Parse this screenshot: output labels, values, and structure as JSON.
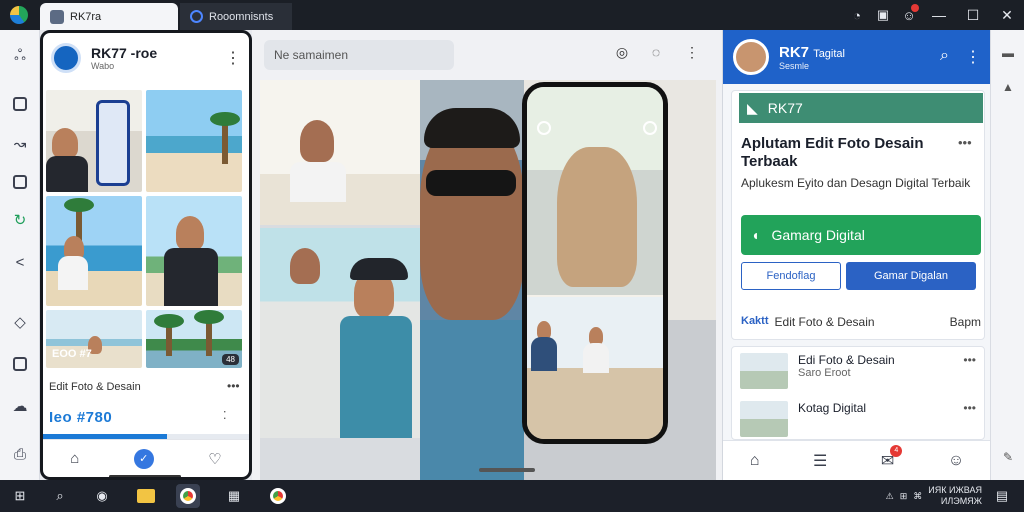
{
  "window": {
    "tabs": [
      {
        "label": "RK7ra",
        "active": true
      },
      {
        "label": "Rooomnisnts",
        "active": false
      }
    ]
  },
  "rail": {
    "icons": [
      "hub-icon",
      "edit-icon",
      "gesture-icon",
      "upload-icon",
      "sync-icon",
      "share-icon",
      "tag-icon",
      "chat-icon",
      "cloud-icon",
      "print-icon"
    ]
  },
  "phone": {
    "header_title": "RK77 -roe",
    "header_sub": "Wabo",
    "tile_caption": "EOO #7",
    "tile_badge": "48",
    "caption": "Edit Foto & Desain",
    "stat": "Ieo #780",
    "progress": 0.6
  },
  "center": {
    "search_placeholder": "Ne samaimen"
  },
  "right": {
    "header_title": "RK7",
    "header_title_small": "Tagital",
    "header_sub": "Sesmle",
    "brand": "RK77",
    "title": "Aplutam Edit Foto Desain Terbaak",
    "subtitle": "Aplukesm Eyito dan Desagn Digital Terbaik",
    "primary_button": "Gamarg Digital",
    "btn_outline": "Fendoflag",
    "btn_fill": "Gamar Digalan",
    "row_prefix": "Kaktt",
    "row_text": "Edit Foto & Desain",
    "row_right": "Bapm",
    "list": [
      {
        "title": "Edi Foto & Desain",
        "sub": "Saro Eroot"
      },
      {
        "title": "Kotag Digital",
        "sub": ""
      }
    ],
    "nav_badge": "4"
  },
  "taskbar": {
    "clock_line1": "ИЯК ИЖВАЯ",
    "clock_line2": "ИЛЭМЯЖ"
  },
  "colors": {
    "accent_blue": "#1f62c9",
    "accent_green": "#22a35a",
    "brand_teal": "#3e8d73",
    "notification_red": "#e53935"
  }
}
